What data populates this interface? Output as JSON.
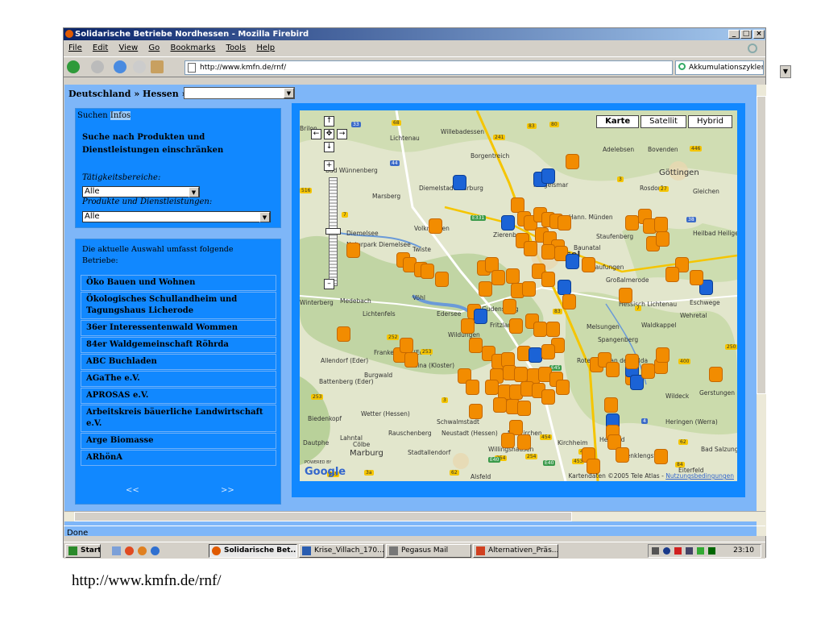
{
  "window": {
    "title": "Solidarische Betriebe Nordhessen - Mozilla Firebird",
    "controls": {
      "minimize": "_",
      "maximize": "□",
      "close": "×"
    }
  },
  "menu": [
    "File",
    "Edit",
    "View",
    "Go",
    "Bookmarks",
    "Tools",
    "Help"
  ],
  "toolbar": {
    "url": "http://www.kmfn.de/rnf/",
    "search": "Akkumulationszyklen"
  },
  "page": {
    "breadcrumb": "Deutschland » Hessen »",
    "tabs": {
      "search": "Suchen",
      "info": "Infos"
    },
    "filter": {
      "heading": "Suche nach Produkten und Dienstleistungen einschränken",
      "label1": "Tätigkeitsbereiche:",
      "value1": "Alle",
      "label2": "Produkte und Dienstleistungen:",
      "value2": "Alle"
    },
    "results": {
      "intro": "Die aktuelle Auswahl umfasst folgende Betriebe:",
      "items": [
        "Öko Bauen und Wohnen",
        "Ökologisches Schullandheim und Tagungshaus Licherode",
        "36er Interessentenwald Wommen",
        "84er Waldgemeinschaft Röhrda",
        "ABC Buchladen",
        "AGaThe e.V.",
        "APROSAS e.V.",
        "Arbeitskreis bäuerliche Landwirtschaft e.V.",
        "Arge Biomasse",
        "ARhönA"
      ],
      "prev": "<<",
      "next": ">>"
    }
  },
  "map": {
    "types": [
      "Karte",
      "Satellit",
      "Hybrid"
    ],
    "nav": {
      "up": "↑",
      "left": "←",
      "center": "✥",
      "right": "→",
      "down": "↓",
      "zoom_in": "+",
      "zoom_out": "–"
    },
    "towns": [
      "Lichtenau",
      "Willebadessen",
      "Borgentreich",
      "Bad Wünnenberg",
      "Marsberg",
      "Diemelstadt",
      "Warburg",
      "Hofgeismar",
      "Adelebsen",
      "Bovenden",
      "Göttingen",
      "Rosdorf",
      "Gleichen",
      "Volkmarsen",
      "Twiste",
      "Zierenberg",
      "Hann. Münden",
      "Staufenberg",
      "Heilbad Heiligenstadt",
      "Diemelsee",
      "Naturpark Diemelsee",
      "Kassel",
      "Baunatal",
      "Kaufungen",
      "Großalmerode",
      "Eschwege",
      "Hessisch Lichtenau",
      "Wehretal",
      "Winterberg",
      "Medebach",
      "Vöhl",
      "Edersee",
      "Lichtenfels",
      "Gudensberg",
      "Fritzlar",
      "Wildungen",
      "Melsungen",
      "Spangenberg",
      "Waldkappel",
      "Allendorf (Eder)",
      "Frankenberg (Eder)",
      "Haina (Kloster)",
      "Battenberg (Eder)",
      "Burgwald",
      "Rotenburg an der Fulda",
      "Wildeck",
      "Gerstungen",
      "Biedenkopf",
      "Wetter (Hessen)",
      "Schwalmstadt",
      "Heringen (Werra)",
      "Rauschenberg",
      "Neustadt (Hessen)",
      "Neukirchen",
      "Kirchheim",
      "Hersfeld",
      "Lahntal",
      "Cölbe",
      "Willingshausen",
      "Schenklengsfeld",
      "Bad Salzungen",
      "Marburg",
      "Stadtallendorf",
      "Alsfeld",
      "Eiterfeld",
      "Dautphe",
      "Brilon"
    ],
    "roads": [
      "33",
      "68",
      "241",
      "83",
      "80",
      "44",
      "446",
      "7",
      "27",
      "3",
      "38",
      "E331",
      "516",
      "83",
      "7",
      "253",
      "252",
      "253",
      "3",
      "49",
      "254",
      "62",
      "E40",
      "84",
      "4",
      "E45",
      "453",
      "400",
      "62",
      "254",
      "255",
      "3a",
      "454",
      "453",
      "E40",
      "250"
    ],
    "copyright": "Kartendaten ©2005 Tele Atlas -",
    "terms": "Nutzungsbedingungen",
    "logo": "Google",
    "powered": "POWERED BY"
  },
  "status": "Done",
  "taskbar": {
    "start": "Start",
    "tasks": [
      "Solidarische Bet...",
      "Krise_Villach_170...",
      "Pegasus Mail",
      "Alternativen_Präs..."
    ],
    "clock": "23:10"
  },
  "caption": "http://www.kmfn.de/rnf/",
  "colors": {
    "panel": "#1188ff",
    "content_bg": "#7eb6f8",
    "marker_orange": "#f28c00",
    "marker_blue": "#1b63d6",
    "titlebar": "#0a246a"
  }
}
